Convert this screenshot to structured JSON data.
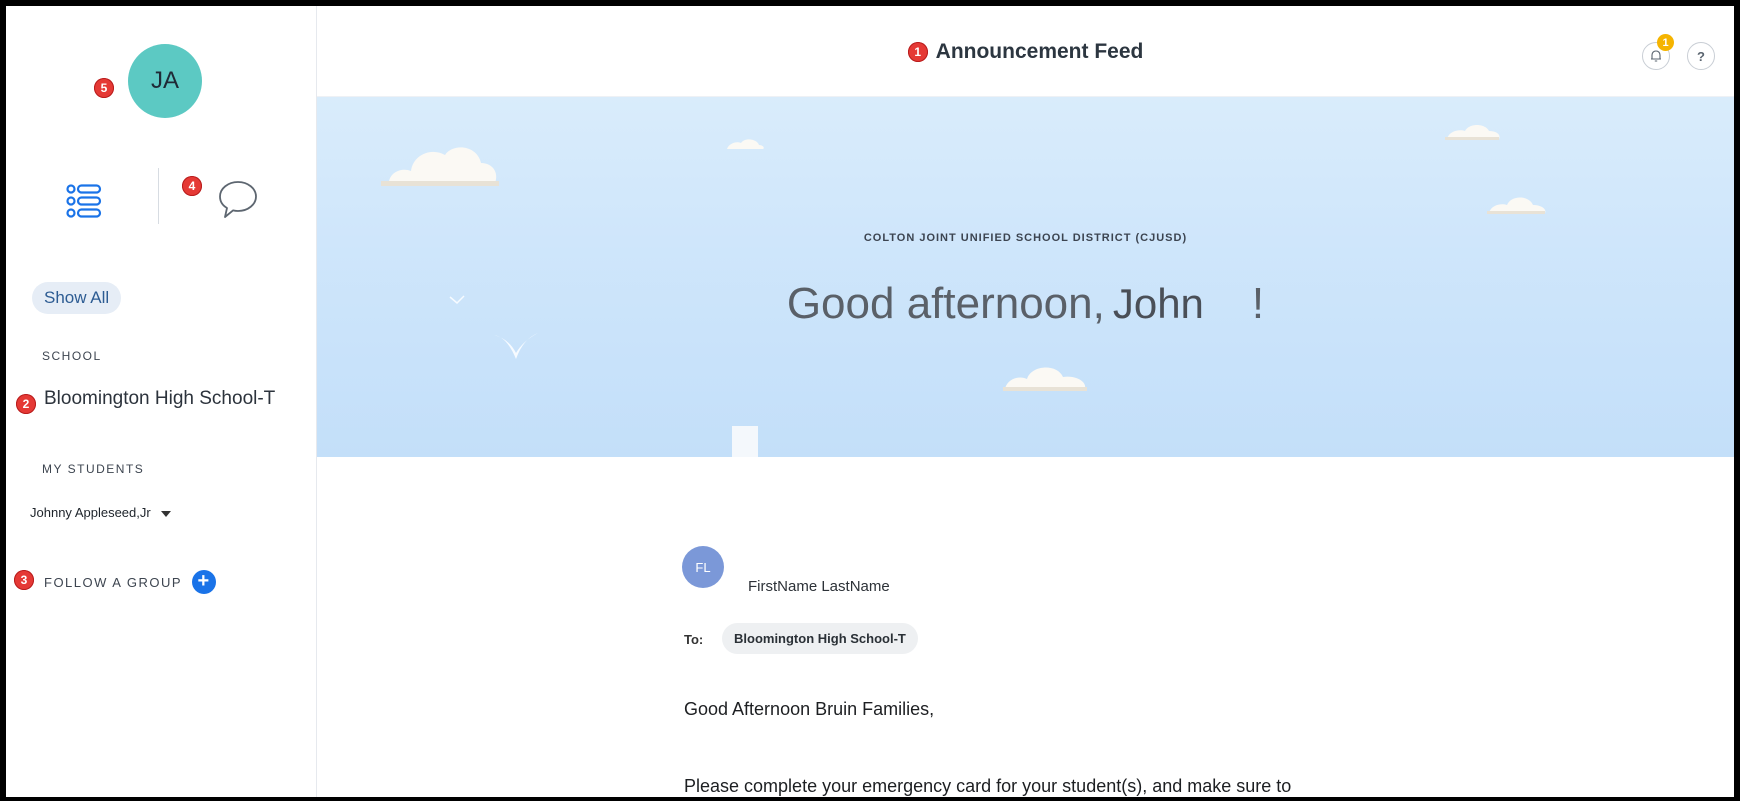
{
  "sidebar": {
    "avatar_initials": "JA",
    "show_all_label": "Show All",
    "school_section_label": "SCHOOL",
    "school_name": "Bloomington High School-T",
    "students_section_label": "MY STUDENTS",
    "selected_student": "Johnny Appleseed,Jr",
    "follow_group_label": "FOLLOW A GROUP",
    "follow_group_icon": "plus-icon",
    "view_icons": [
      "list-icon",
      "chat-bubble-icon"
    ]
  },
  "header": {
    "title": "Announcement Feed",
    "notification_count": "1",
    "help_label": "?",
    "notification_icon": "bell-icon"
  },
  "annotations": {
    "title_marker": "1",
    "school_marker": "2",
    "follow_marker": "3",
    "chat_marker": "4",
    "avatar_marker": "5"
  },
  "hero": {
    "district": "COLTON JOINT UNIFIED SCHOOL DISTRICT (CJUSD)",
    "greeting": "Good afternoon,",
    "name": "John",
    "exclamation": "!"
  },
  "post": {
    "author_initials": "FL",
    "author_name": "FirstName LastName",
    "to_label": "To:",
    "recipient": "Bloomington High School-T",
    "body_line1": "Good Afternoon Bruin Families,",
    "body_line2": "Please complete your emergency card for your student(s), and make sure to"
  },
  "colors": {
    "avatar_bg": "#5cc9c3",
    "accent_blue": "#1a73e8",
    "marker_red": "#e53935",
    "badge_yellow": "#f5b400",
    "hero_sky": "#cfe6fb"
  }
}
